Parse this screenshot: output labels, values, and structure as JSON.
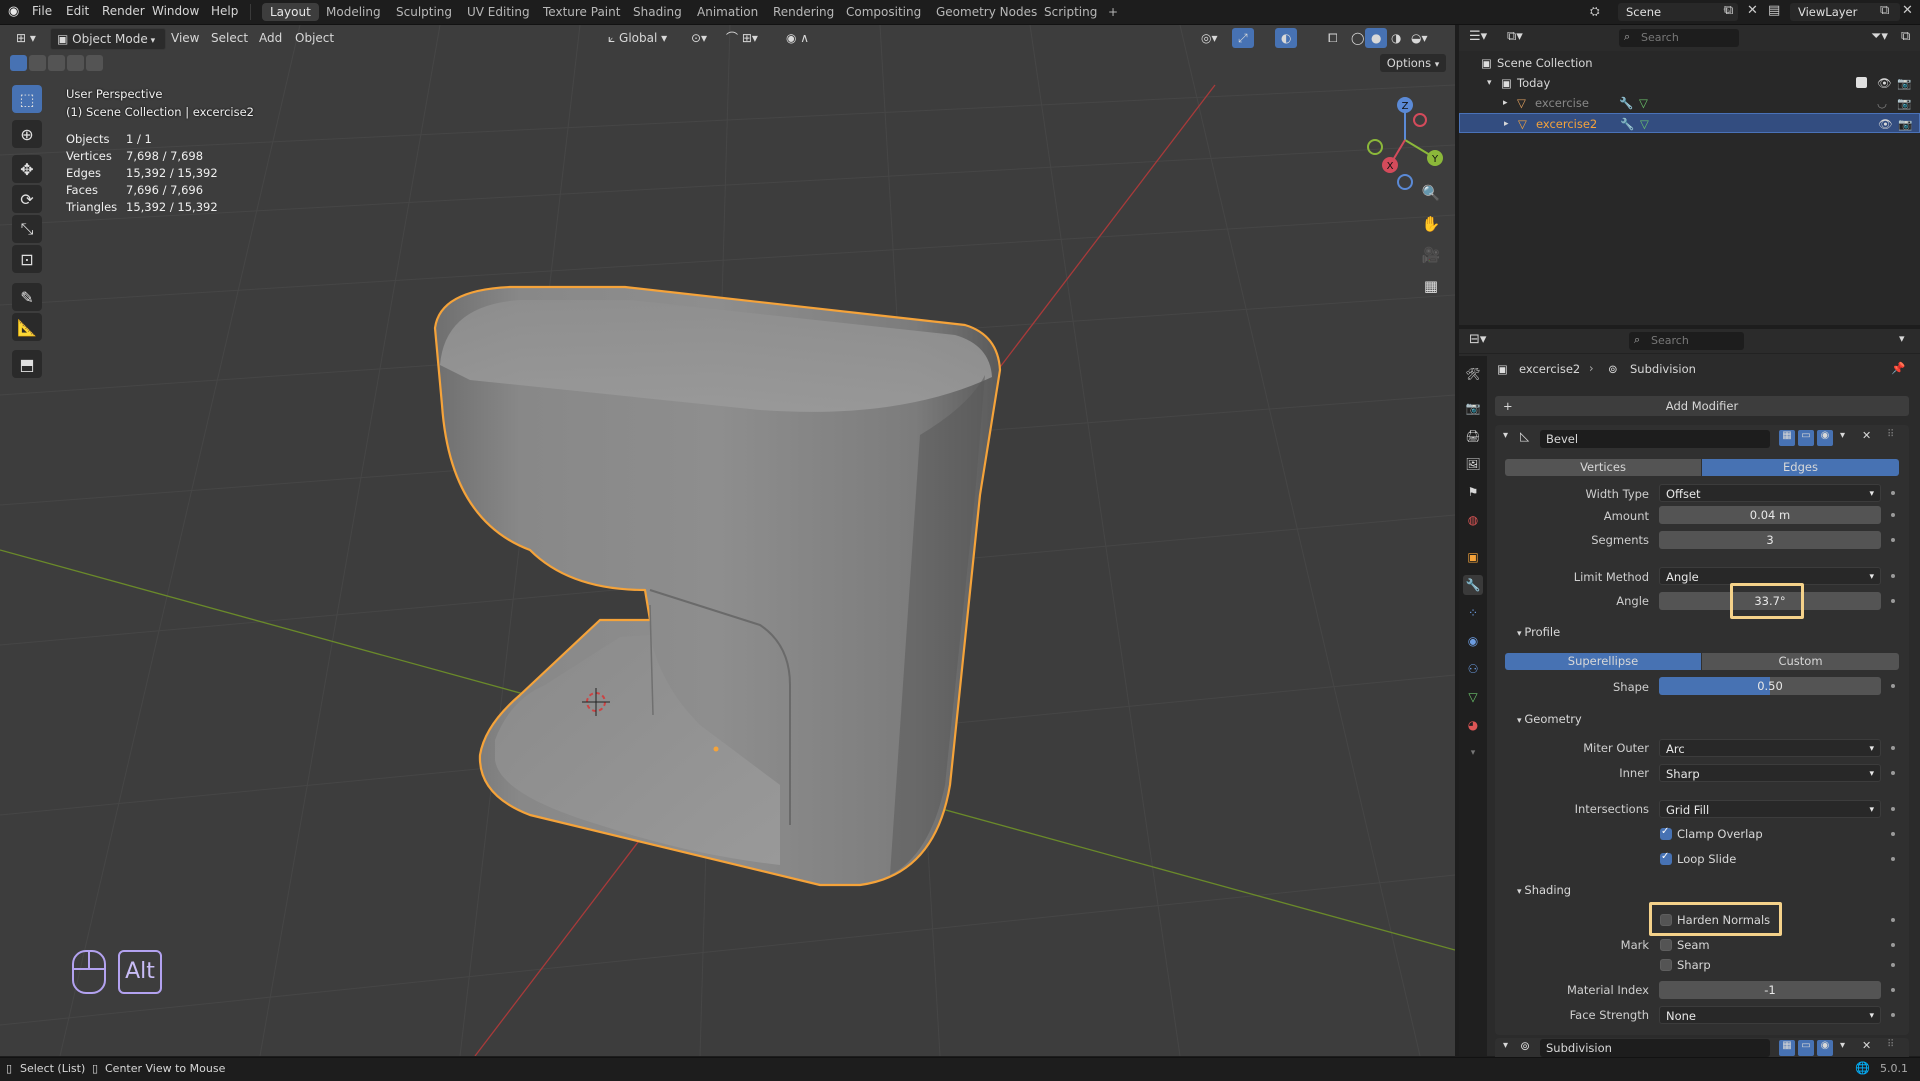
{
  "topbar": {
    "menus": [
      "File",
      "Edit",
      "Render",
      "Window",
      "Help"
    ],
    "workspaces": [
      "Layout",
      "Modeling",
      "Sculpting",
      "UV Editing",
      "Texture Paint",
      "Shading",
      "Animation",
      "Rendering",
      "Compositing",
      "Geometry Nodes",
      "Scripting"
    ],
    "active_workspace": "Layout",
    "add_tab": "+",
    "scene": "Scene",
    "view_layer": "ViewLayer"
  },
  "viewport_header": {
    "mode": "Object Mode",
    "menus": [
      "View",
      "Select",
      "Add",
      "Object"
    ],
    "transform_orientation": "Global",
    "options": "Options"
  },
  "viewport_overlay": {
    "perspective": "User Perspective",
    "collection": "(1) Scene Collection | excercise2",
    "stats": [
      {
        "label": "Objects",
        "value": "1 / 1"
      },
      {
        "label": "Vertices",
        "value": "7,698 / 7,698"
      },
      {
        "label": "Edges",
        "value": "15,392 / 15,392"
      },
      {
        "label": "Faces",
        "value": "7,696 / 7,696"
      },
      {
        "label": "Triangles",
        "value": "15,392 / 15,392"
      }
    ],
    "gizmo_axes": {
      "x": "X",
      "y": "Y",
      "z": "Z"
    },
    "keys": {
      "alt": "Alt"
    }
  },
  "outliner": {
    "search_placeholder": "Search",
    "root": "Scene Collection",
    "collection": "Today",
    "objects": [
      {
        "name": "excercise",
        "selected": false
      },
      {
        "name": "excercise2",
        "selected": true
      }
    ]
  },
  "properties": {
    "search_placeholder": "Search",
    "breadcrumb_object": "excercise2",
    "breadcrumb_modifier": "Subdivision",
    "add_modifier": "Add Modifier",
    "bevel": {
      "name": "Bevel",
      "affect": [
        "Vertices",
        "Edges"
      ],
      "affect_selected": "Edges",
      "width_type_label": "Width Type",
      "width_type": "Offset",
      "amount_label": "Amount",
      "amount": "0.04 m",
      "segments_label": "Segments",
      "segments": "3",
      "limit_method_label": "Limit Method",
      "limit_method": "Angle",
      "angle_label": "Angle",
      "angle": "33.7°",
      "profile_header": "Profile",
      "profile_types": [
        "Superellipse",
        "Custom"
      ],
      "shape_label": "Shape",
      "shape": "0.50",
      "geometry_header": "Geometry",
      "miter_outer_label": "Miter Outer",
      "miter_outer": "Arc",
      "inner_label": "Inner",
      "inner": "Sharp",
      "intersections_label": "Intersections",
      "intersections": "Grid Fill",
      "clamp_overlap": "Clamp Overlap",
      "loop_slide": "Loop Slide",
      "shading_header": "Shading",
      "harden_normals": "Harden Normals",
      "mark_label": "Mark",
      "seam": "Seam",
      "sharp": "Sharp",
      "material_index_label": "Material Index",
      "material_index": "-1",
      "face_strength_label": "Face Strength",
      "face_strength": "None"
    },
    "subdivision_name": "Subdivision"
  },
  "statusbar": {
    "left1": "Select (List)",
    "left2": "Center View to Mouse",
    "version": "5.0.1"
  },
  "colors": {
    "accent": "#4772b3",
    "selection": "#f5a33a",
    "highlight": "#f5d28a"
  }
}
